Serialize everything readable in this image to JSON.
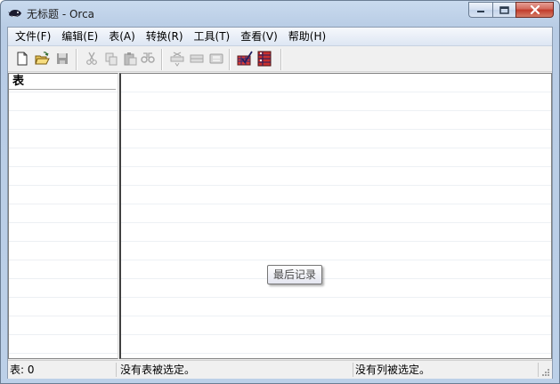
{
  "window": {
    "title": "无标题 - Orca",
    "app_icon": "orca-whale-icon"
  },
  "caption_buttons": {
    "minimize_icon": "minimize-icon",
    "maximize_icon": "maximize-icon",
    "close_icon": "close-icon",
    "close_color": "#c13a2a"
  },
  "menubar": {
    "items": [
      {
        "label": "文件(F)"
      },
      {
        "label": "编辑(E)"
      },
      {
        "label": "表(A)"
      },
      {
        "label": "转换(R)"
      },
      {
        "label": "工具(T)"
      },
      {
        "label": "查看(V)"
      },
      {
        "label": "帮助(H)"
      }
    ]
  },
  "toolbar": {
    "buttons": [
      {
        "icon": "new-file-icon",
        "enabled": true
      },
      {
        "icon": "open-folder-icon",
        "enabled": true
      },
      {
        "icon": "save-icon",
        "enabled": false
      },
      {
        "icon": "cut-icon",
        "enabled": false
      },
      {
        "icon": "copy-icon",
        "enabled": false
      },
      {
        "icon": "paste-icon",
        "enabled": false
      },
      {
        "icon": "find-icon",
        "enabled": false
      },
      {
        "icon": "add-row-icon",
        "enabled": false
      },
      {
        "icon": "drop-row-icon",
        "enabled": false
      },
      {
        "icon": "table-properties-icon",
        "enabled": false
      },
      {
        "icon": "validate-icon",
        "enabled": true
      },
      {
        "icon": "tables-view-icon",
        "enabled": true
      }
    ]
  },
  "tables_pane": {
    "header": "表"
  },
  "rows_pane": {
    "tooltip": "最后记录"
  },
  "statusbar": {
    "table_count": "表: 0",
    "table_selection": "没有表被选定。",
    "column_selection": "没有列被选定。"
  }
}
